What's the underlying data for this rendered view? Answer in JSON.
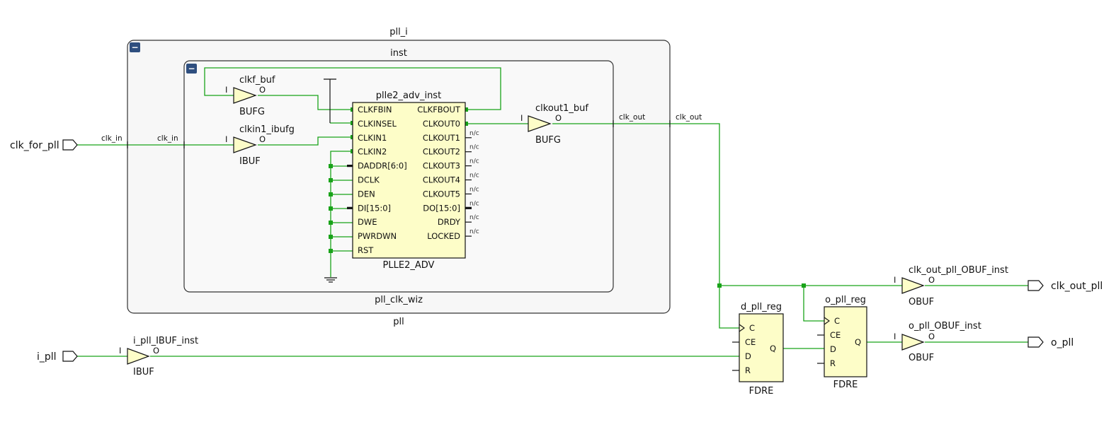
{
  "colors": {
    "wire": "#19a319",
    "cell_fill": "#fdfdc8",
    "hier_fill": "#f7f7f7"
  },
  "hier": {
    "outer_top": "pll_i",
    "outer_bottom": "pll",
    "inner_top": "inst",
    "inner_bottom": "pll_clk_wiz",
    "collapse_icon": "−"
  },
  "ports": {
    "clk_for_pll": "clk_for_pll",
    "i_pll": "i_pll",
    "clk_out_pll": "clk_out_pll",
    "o_pll": "o_pll"
  },
  "nets": {
    "clk_in_outer": "clk_in",
    "clk_in_inner": "clk_in",
    "clk_out_inner": "clk_out",
    "clk_out_outer": "clk_out"
  },
  "buffers": {
    "clkf_buf": {
      "name": "clkf_buf",
      "type": "BUFG",
      "in": "I",
      "out": "O"
    },
    "clkin1_ibufg": {
      "name": "clkin1_ibufg",
      "type": "IBUF",
      "in": "I",
      "out": "O"
    },
    "clkout1_buf": {
      "name": "clkout1_buf",
      "type": "BUFG",
      "in": "I",
      "out": "O"
    },
    "clk_out_pll_obuf": {
      "name": "clk_out_pll_OBUF_inst",
      "type": "OBUF",
      "in": "I",
      "out": "O"
    },
    "o_pll_obuf": {
      "name": "o_pll_OBUF_inst",
      "type": "OBUF",
      "in": "I",
      "out": "O"
    },
    "i_pll_ibuf": {
      "name": "i_pll_IBUF_inst",
      "type": "IBUF",
      "in": "I",
      "out": "O"
    }
  },
  "pll": {
    "name": "plle2_adv_inst",
    "type": "PLLE2_ADV",
    "inputs": [
      "CLKFBIN",
      "CLKINSEL",
      "CLKIN1",
      "CLKIN2",
      "DADDR[6:0]",
      "DCLK",
      "DEN",
      "DI[15:0]",
      "DWE",
      "PWRDWN",
      "RST"
    ],
    "outputs": [
      "CLKFBOUT",
      "CLKOUT0",
      "CLKOUT1",
      "CLKOUT2",
      "CLKOUT3",
      "CLKOUT4",
      "CLKOUT5",
      "DO[15:0]",
      "DRDY",
      "LOCKED"
    ],
    "nc": "n/c"
  },
  "flops": {
    "d_pll_reg": {
      "name": "d_pll_reg",
      "type": "FDRE",
      "pins": [
        "C",
        "CE",
        "D",
        "R"
      ],
      "q": "Q"
    },
    "o_pll_reg": {
      "name": "o_pll_reg",
      "type": "FDRE",
      "pins": [
        "C",
        "CE",
        "D",
        "R"
      ],
      "q": "Q"
    }
  }
}
